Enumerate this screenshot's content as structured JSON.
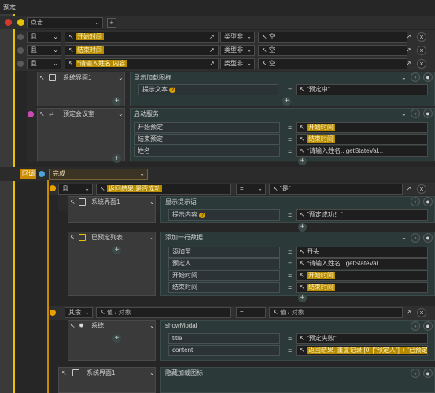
{
  "title": "预定",
  "event": {
    "label": "点击"
  },
  "conditions": [
    {
      "logic": "且",
      "field": "开始时间",
      "op": "类型非",
      "value": "空"
    },
    {
      "logic": "且",
      "field": "结束时间",
      "op": "类型非",
      "value": "空"
    },
    {
      "logic": "且",
      "field": "*请输入姓名.内容",
      "op": "类型非",
      "value": "空"
    }
  ],
  "action1": {
    "target": "系统界面1",
    "action": "显示加载图标",
    "param_label": "提示文本",
    "param_value": "\"预定中\""
  },
  "action2": {
    "target": "预定会议室",
    "action": "启动服务",
    "params": [
      {
        "label": "开始预定",
        "value": "开始时间"
      },
      {
        "label": "结束预定",
        "value": "结束时间"
      },
      {
        "label": "姓名",
        "value": "*请输入姓名...getStateVal..."
      }
    ]
  },
  "callback": {
    "badge": "回调",
    "label": "完成"
  },
  "cond2": {
    "logic": "且",
    "field": "返回结果.是否成功",
    "op": "=",
    "value": "\"是\""
  },
  "action3": {
    "target": "系统界面1",
    "action": "显示提示语",
    "param_label": "提示内容",
    "param_value": "\"预定成功！\""
  },
  "action4": {
    "target": "已预定列表",
    "action": "添加一行数据",
    "params": [
      {
        "label": "添加至",
        "value": "开头"
      },
      {
        "label": "预定人",
        "value": "*请输入姓名...getStateVal..."
      },
      {
        "label": "开始时间",
        "value": "开始时间"
      },
      {
        "label": "结束时间",
        "value": "结束时间"
      }
    ]
  },
  "else": {
    "logic": "其余",
    "field": "值 / 对象",
    "op": "=",
    "value": "值 / 对象"
  },
  "action5": {
    "target": "系统",
    "action": "showModal",
    "params": [
      {
        "label": "title",
        "value": "\"预定失败\""
      },
      {
        "label": "content",
        "value": "返回结果. 重复记录 [0] [\"预定人\"] + \"已预定"
      }
    ]
  },
  "action6": {
    "target": "系统界面1",
    "action": "隐藏加载图标"
  },
  "symbols": {
    "plus": "+",
    "chev": "⌄",
    "eq": "=",
    "pin": "↖",
    "expand": "↗",
    "help": "?"
  },
  "colors": {
    "accent": "#e6c400",
    "teal": "#2b3a38",
    "callback": "#c98a00"
  }
}
